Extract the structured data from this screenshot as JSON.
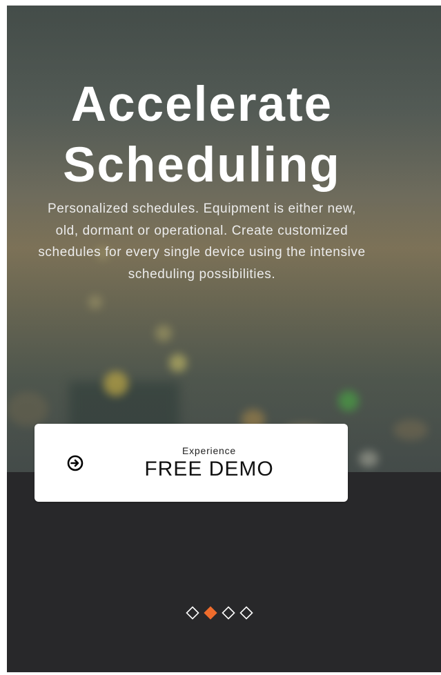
{
  "hero": {
    "title_line1": "Accelerate",
    "title_line2": "Scheduling",
    "description": "Personalized schedules. Equipment is either new, old, dormant or operational. Create customized schedules for every single device using the intensive scheduling possibilities."
  },
  "cta": {
    "small_label": "Experience",
    "label": "FREE DEMO",
    "icon": "arrow-circle-right-icon"
  },
  "slider": {
    "total_slides": 4,
    "active_index": 2,
    "active_color": "#ef6c2c",
    "inactive_color": "#ffffff"
  },
  "colors": {
    "panel_background": "#28282a",
    "button_background": "#ffffff",
    "text_light": "#ffffff"
  }
}
